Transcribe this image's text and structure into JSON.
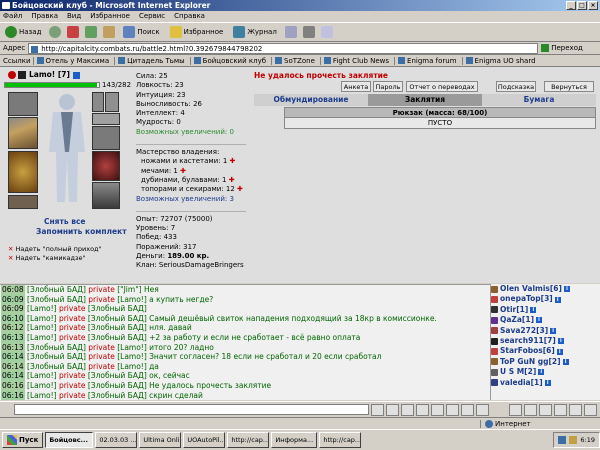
{
  "window": {
    "title": "Бойцовский клуб - Microsoft Internet Explorer"
  },
  "menu": [
    "Файл",
    "Правка",
    "Вид",
    "Избранное",
    "Сервис",
    "Справка"
  ],
  "toolbar": {
    "back": "Назад",
    "search": "Поиск",
    "favorites": "Избранное",
    "journal": "Журнал"
  },
  "address": {
    "label": "Адрес",
    "url": "http://capitalcity.combats.ru/battle2.html?0.392679844798202",
    "go": "Переход"
  },
  "links": {
    "label": "Ссылки",
    "items": [
      "Отель у Максима",
      "Цитадель Тьмы",
      "Бойцовский клуб",
      "SoTZone",
      "Fight Club News",
      "Enigma forum",
      "Enigma UO shard"
    ]
  },
  "character": {
    "name": "Lamo!",
    "level": "[7]",
    "hp": "143/282",
    "hp_fraction": 0.98,
    "remove_all": "Снять все",
    "remember_set": "Запомнить комплект",
    "option1": "Надеть \"полный приход\"",
    "option2": "Надеть \"камикадзе\""
  },
  "stats": {
    "strength": "Сила: 25",
    "agility": "Ловкость: 23",
    "intuition": "Интуиция: 23",
    "endurance": "Выносливость: 26",
    "intellect": "Интеллект: 4",
    "wisdom": "Мудрость: 0",
    "free_upgrades": "Возможных увеличений: 0",
    "mastery_title": "Мастерство владения:",
    "m1": "ножами и кастетами: 1",
    "m2": "мечами: 1",
    "m3": "дубинами, булавами: 1",
    "m4": "топорами и секирами: 12",
    "free_mastery": "Возможных увеличений: 3",
    "exp": "Опыт: 72707 (75000)",
    "level": "Уровень: 7",
    "wins": "Побед: 433",
    "losses": "Поражений: 317",
    "money_label": "Деньги:",
    "money": "189.00 кр.",
    "clan": "Клан: SeriousDamageBringers"
  },
  "right": {
    "error": "Не удалось прочесть заклятие",
    "btns": [
      "Анкета",
      "Пароль",
      "Отчет о переводах",
      "Подсказка",
      "Вернуться"
    ],
    "tabs": [
      "Обмундирование",
      "Заклятия",
      "Бумага"
    ],
    "inventory_title": "Рюкзак (масса: 68/100)",
    "inventory_empty": "ПУСТО"
  },
  "chat": [
    {
      "t": "06:08",
      "text": "[Злобный БАД] private [\"Jim\"] Нея"
    },
    {
      "t": "06:09",
      "text": "[Злобный БАД] private [Lamo!] а купить негде?"
    },
    {
      "t": "06:09",
      "text": "[Lamo!] private [Злобный БАД]"
    },
    {
      "t": "06:10",
      "text": "[Lamo!] private [Злобный БАД] Самый дешёвый свиток нападения подходящий за 18кр в комиссионке."
    },
    {
      "t": "06:12",
      "text": "[Lamo!] private [Злобный БАД] нля. давай"
    },
    {
      "t": "06:13",
      "text": "[Lamo!] private [Злобный БАД] +2 за работу и если не сработает - всё равно оплата"
    },
    {
      "t": "06:13",
      "text": "[Злобный БАД] private [Lamo!] итого 20? ладно"
    },
    {
      "t": "06:14",
      "text": "[Злобный БАД] private [Lamo!] Значит согласен? 18 если не сработал и 20 если сработал"
    },
    {
      "t": "06:14",
      "text": "[Злобный БАД] private [Lamo!] да"
    },
    {
      "t": "06:14",
      "text": "[Lamo!] private [Злобный БАД] ок, сейчас"
    },
    {
      "t": "06:16",
      "text": "[Lamo!] private [Злобный БАД] Не удалось прочесть заклятие"
    },
    {
      "t": "06:16",
      "text": "[Lamo!] private [Злобный БАД] скрин сделай"
    }
  ],
  "users": [
    "Olen Valmis[6]",
    "onepaTop[3]",
    "Otir[1]",
    "QaZa[1]",
    "Sava272[3]",
    "search911[7]",
    "StarFobos[6]",
    "ToP GuN gg[2]",
    "U S M[2]",
    "valedia[1]"
  ],
  "status": {
    "left": "",
    "zone": "Интернет"
  },
  "taskbar": {
    "start": "Пуск",
    "items": [
      "Бойцовс...",
      "02.03.03 ...",
      "Ultima Onli...",
      "UOAutoPil...",
      "http://cap...",
      "Информа...",
      "http://cap..."
    ],
    "clock": "6:19"
  }
}
